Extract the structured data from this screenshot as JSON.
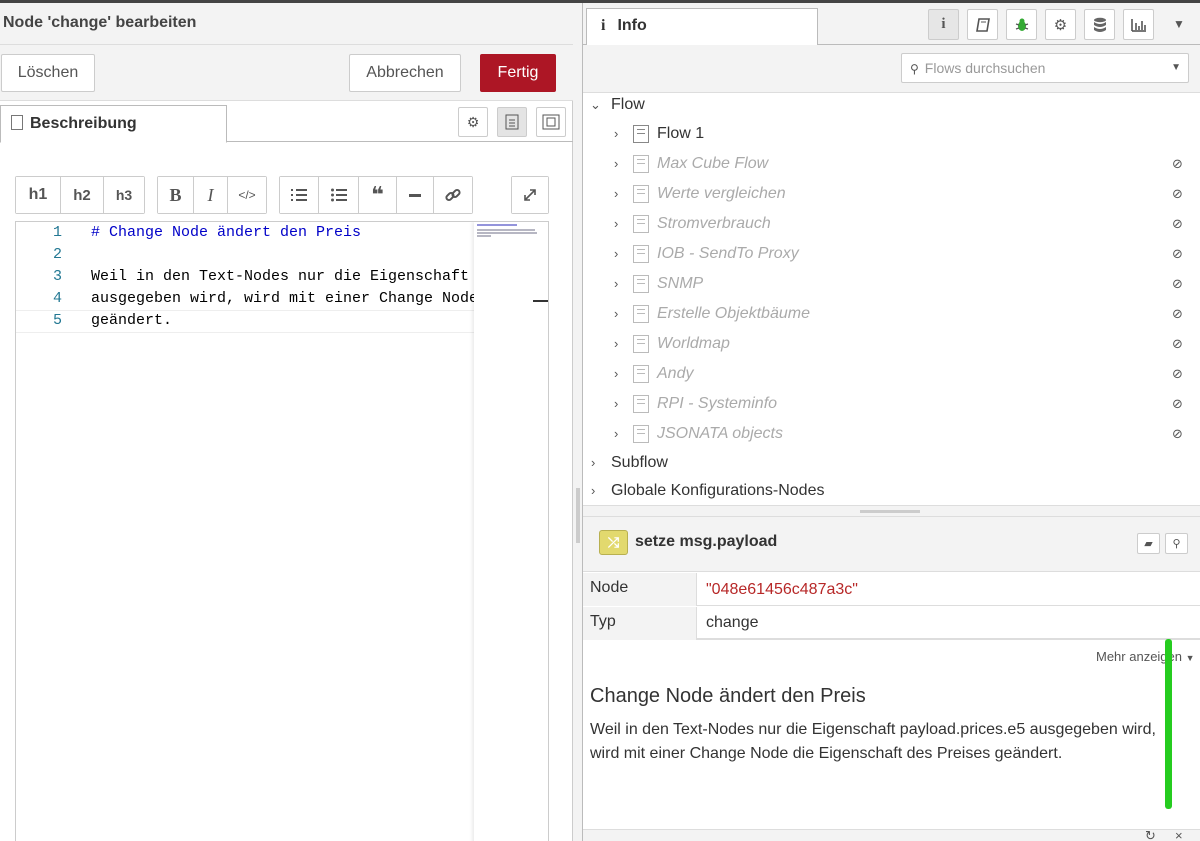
{
  "editor_panel": {
    "title": "Node 'change' bearbeiten",
    "delete_label": "Löschen",
    "cancel_label": "Abbrechen",
    "done_label": "Fertig",
    "tab_label": "Beschreibung",
    "toolbar": {
      "h1": "h1",
      "h2": "h2",
      "h3": "h3",
      "bold": "B",
      "italic": "I"
    },
    "code_lines": [
      {
        "num": "1",
        "text": "# Change Node ändert den Preis"
      },
      {
        "num": "2",
        "text": ""
      },
      {
        "num": "3",
        "text": "Weil in den Text-Nodes nur die Eigenschaft"
      },
      {
        "num": "4",
        "text": "ausgegeben wird, wird mit einer Change Node"
      },
      {
        "num": "5",
        "text": "geändert."
      }
    ]
  },
  "sidebar": {
    "tab_label": "Info",
    "search_placeholder": "Flows durchsuchen",
    "tree": {
      "flow_section": "Flow",
      "flows": [
        {
          "name": "Flow 1",
          "disabled": false
        },
        {
          "name": "Max Cube Flow",
          "disabled": true
        },
        {
          "name": "Werte vergleichen",
          "disabled": true
        },
        {
          "name": "Stromverbrauch",
          "disabled": true
        },
        {
          "name": "IOB - SendTo Proxy",
          "disabled": true
        },
        {
          "name": "SNMP",
          "disabled": true
        },
        {
          "name": "Erstelle Objektbäume",
          "disabled": true
        },
        {
          "name": "Worldmap",
          "disabled": true
        },
        {
          "name": "Andy",
          "disabled": true
        },
        {
          "name": "RPI - Systeminfo",
          "disabled": true
        },
        {
          "name": "JSONATA objects",
          "disabled": true
        }
      ],
      "subflow_section": "Subflow",
      "config_section": "Globale Konfigurations-Nodes"
    },
    "node_info": {
      "title": "setze msg.payload",
      "rows": [
        {
          "key": "Node",
          "value": "\"048e61456c487a3c\""
        },
        {
          "key": "Typ",
          "value": "change"
        }
      ],
      "more_label": "Mehr anzeigen",
      "help_title": "Change Node ändert den Preis",
      "help_text": "Weil in den Text-Nodes nur die Eigenschaft payload.prices.e5 ausgegeben wird, wird mit einer Change Node die Eigenschaft des Preises geändert."
    }
  },
  "colors": {
    "done_button": "#ad1625",
    "node_color": "#e2d96e",
    "string_value": "#b72828",
    "scroll_highlight": "#25cc1f"
  }
}
